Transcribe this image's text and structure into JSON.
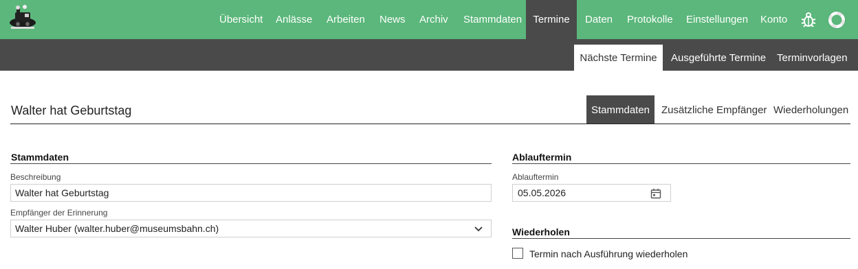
{
  "nav": {
    "items": [
      "Übersicht",
      "Anlässe",
      "Arbeiten",
      "News",
      "Archiv",
      "Stammdaten",
      "Termine",
      "Daten",
      "Protokolle",
      "Einstellungen",
      "Konto"
    ]
  },
  "subnav": {
    "items": [
      "Nächste Termine",
      "Ausgeführte Termine",
      "Terminvorlagen"
    ]
  },
  "page": {
    "title": "Walter hat Geburtstag",
    "tabs": [
      "Stammdaten",
      "Zusätzliche Empfänger",
      "Wiederholungen"
    ]
  },
  "stammdaten": {
    "heading": "Stammdaten",
    "beschreibung_label": "Beschreibung",
    "beschreibung_value": "Walter hat Geburtstag",
    "empfaenger_label": "Empfänger der Erinnerung",
    "empfaenger_value": "Walter Huber (walter.huber@museumsbahn.ch)"
  },
  "ablauftermin": {
    "heading": "Ablauftermin",
    "label": "Ablauftermin",
    "value": "05.05.2026"
  },
  "wiederholen": {
    "heading": "Wiederholen",
    "checkbox_label": "Termin nach Ausführung wiederholen",
    "checked": false
  },
  "colors": {
    "brand_green": "#5bb77b",
    "dark_bar": "#4a4a4a"
  },
  "icons": {
    "logo": "museumsbahn-locomotive-logo",
    "bug": "bug-icon",
    "help": "lifebuoy-icon",
    "calendar": "calendar-icon",
    "dropdown": "chevron-down-icon"
  }
}
